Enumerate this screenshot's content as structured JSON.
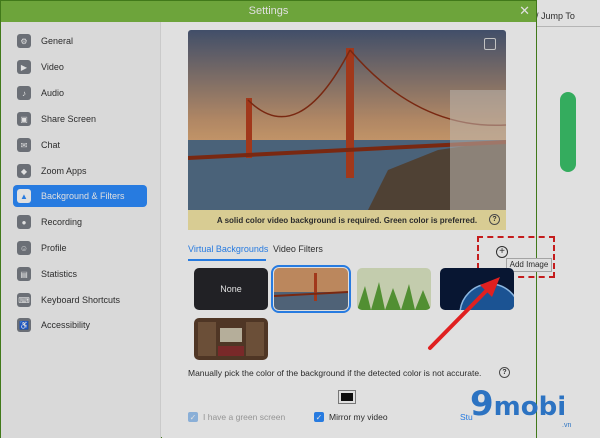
{
  "window": {
    "title": "Settings",
    "close": "✕"
  },
  "background_app": {
    "jump_text": "/ Jump To"
  },
  "sidebar": {
    "items": [
      {
        "label": "General",
        "icon": "gear-icon",
        "glyph": "⚙",
        "active": false
      },
      {
        "label": "Video",
        "icon": "video-icon",
        "glyph": "▶",
        "active": false
      },
      {
        "label": "Audio",
        "icon": "headphones-icon",
        "glyph": "♪",
        "active": false
      },
      {
        "label": "Share Screen",
        "icon": "share-screen-icon",
        "glyph": "▣",
        "active": false
      },
      {
        "label": "Chat",
        "icon": "chat-icon",
        "glyph": "✉",
        "active": false
      },
      {
        "label": "Zoom Apps",
        "icon": "apps-icon",
        "glyph": "◆",
        "active": false
      },
      {
        "label": "Background & Filters",
        "icon": "person-background-icon",
        "glyph": "▲",
        "active": true
      },
      {
        "label": "Recording",
        "icon": "record-icon",
        "glyph": "●",
        "active": false
      },
      {
        "label": "Profile",
        "icon": "profile-icon",
        "glyph": "☺",
        "active": false
      },
      {
        "label": "Statistics",
        "icon": "statistics-icon",
        "glyph": "▤",
        "active": false
      },
      {
        "label": "Keyboard Shortcuts",
        "icon": "keyboard-icon",
        "glyph": "⌨",
        "active": false
      },
      {
        "label": "Accessibility",
        "icon": "accessibility-icon",
        "glyph": "♿",
        "active": false
      }
    ]
  },
  "main": {
    "notice": "A solid color video background is required. Green color is preferred.",
    "notice_help": "?",
    "tabs": [
      {
        "label": "Virtual Backgrounds",
        "active": true
      },
      {
        "label": "Video Filters",
        "active": false
      }
    ],
    "add_image_glyph": "+",
    "add_image_tooltip": "Add Image",
    "none_label": "None",
    "manual_text": "Manually pick the color of the background if the detected color is not accurate.",
    "manual_help": "?",
    "picked_color": "#111111",
    "green_screen_label": "I have a green screen",
    "mirror_label": "Mirror my video",
    "mirror_checked": true,
    "studio_link": "Stu"
  },
  "colors": {
    "accent": "#2d8cff",
    "titlebar": "#7dbb44",
    "annotation": "#e02020",
    "notice_bg": "#f6e9a8"
  },
  "watermark": {
    "digit": "9",
    "word": "mobi",
    "tld": ".vn"
  }
}
